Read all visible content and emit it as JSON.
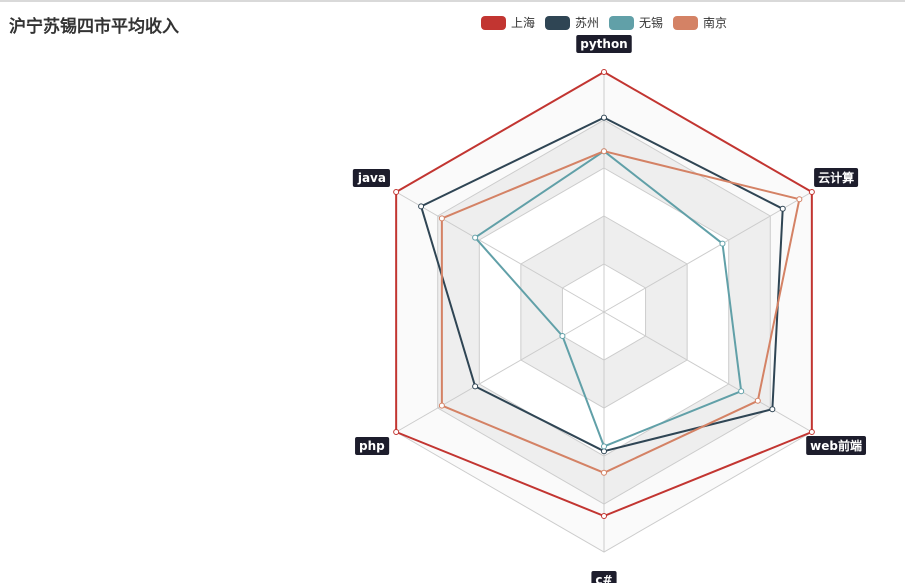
{
  "title": "沪宁苏锡四市平均收入",
  "chart_data": {
    "type": "radar",
    "title": "沪宁苏锡四市平均收入",
    "indicators": [
      "python",
      "云计算",
      "web前端",
      "c#",
      "php",
      "java"
    ],
    "max": 1.0,
    "split_number": 5,
    "series": [
      {
        "name": "上海",
        "color": "#c23531",
        "values": [
          1.0,
          1.0,
          1.0,
          0.85,
          1.0,
          1.0
        ]
      },
      {
        "name": "苏州",
        "color": "#2f4554",
        "values": [
          0.81,
          0.86,
          0.81,
          0.58,
          0.62,
          0.88
        ]
      },
      {
        "name": "无锡",
        "color": "#61a0a8",
        "values": [
          0.67,
          0.57,
          0.66,
          0.56,
          0.2,
          0.62
        ]
      },
      {
        "name": "南京",
        "color": "#d48265",
        "values": [
          0.67,
          0.94,
          0.74,
          0.67,
          0.78,
          0.78
        ]
      }
    ]
  }
}
